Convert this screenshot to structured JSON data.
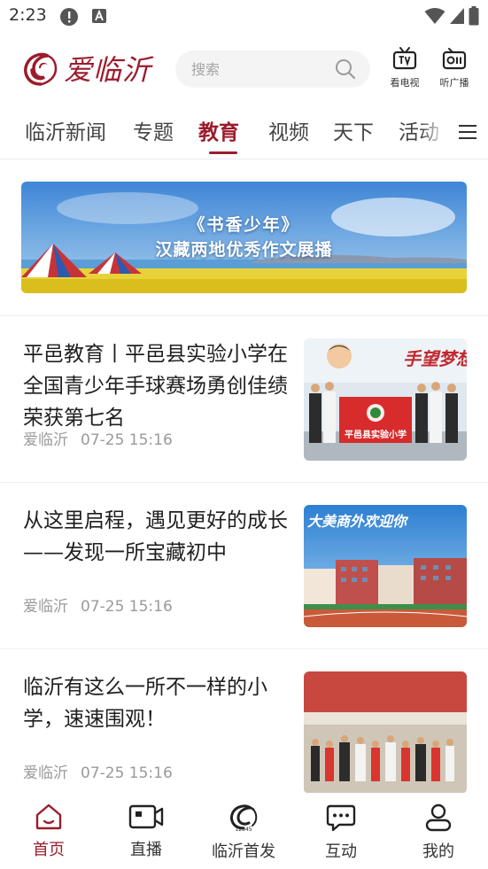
{
  "status_bar": {
    "time": "2:23"
  },
  "header": {
    "logo_text": "爱临沂",
    "search_placeholder": "搜索",
    "tv_label": "看电视",
    "radio_label": "听广播"
  },
  "tabs": [
    {
      "label": "临沂新闻"
    },
    {
      "label": "专题"
    },
    {
      "label": "教育",
      "active": true
    },
    {
      "label": "视频"
    },
    {
      "label": "天下"
    },
    {
      "label": "活动"
    }
  ],
  "banner": {
    "title": "《书香少年》",
    "subtitle": "汉藏两地优秀作文展播"
  },
  "articles": [
    {
      "title": "平邑教育丨平邑县实验小学在全国青少年手球赛场勇创佳绩荣获第七名",
      "source": "爱临沂",
      "time": "07-25 15:16",
      "image_text_1": "手望梦想",
      "image_text_2": "平邑县实验小学"
    },
    {
      "title": "从这里启程，遇见更好的成长——发现一所宝藏初中",
      "source": "爱临沂",
      "time": "07-25 15:16",
      "image_text_1": "大美商外欢迎你"
    },
    {
      "title": "临沂有这么一所不一样的小学，速速围观！",
      "source": "爱临沂",
      "time": "07-25 15:16"
    }
  ],
  "bottom_nav": [
    {
      "label": "首页",
      "icon": "home-icon",
      "active": true
    },
    {
      "label": "直播",
      "icon": "video-camera-icon"
    },
    {
      "label": "临沂首发",
      "icon": "linyi-logo-icon",
      "logo_text": "12345"
    },
    {
      "label": "互动",
      "icon": "chat-bubble-icon"
    },
    {
      "label": "我的",
      "icon": "user-icon"
    }
  ],
  "colors": {
    "brand": "#9b1c2c",
    "text": "#1f1f1f",
    "muted": "#9a9a9a"
  }
}
